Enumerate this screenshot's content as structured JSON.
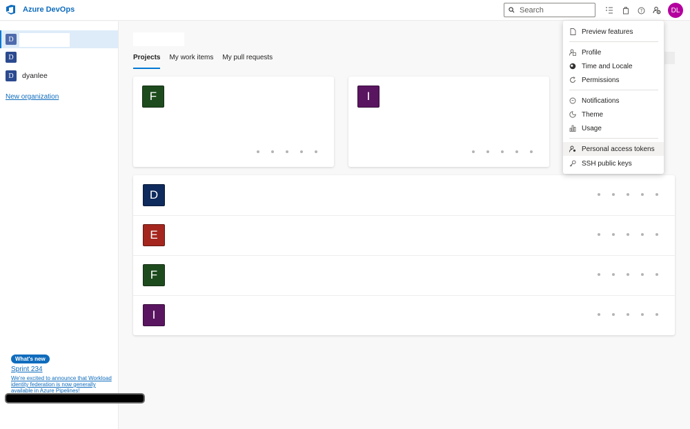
{
  "header": {
    "brand": "Azure DevOps",
    "search_placeholder": "Search",
    "avatar_initials": "DL"
  },
  "sidebar": {
    "orgs": [
      {
        "badge": "D",
        "name": ""
      },
      {
        "badge": "D",
        "name": ""
      },
      {
        "badge": "D",
        "name": "dyanlee"
      }
    ],
    "new_org": "New organization",
    "whats_new": {
      "badge": "What's new",
      "title": "Sprint 234",
      "desc": "We're excited to announce that Workload identity federation is now generally available in Azure Pipelines!"
    }
  },
  "main": {
    "tabs": [
      "Projects",
      "My work items",
      "My pull requests"
    ],
    "cards": [
      {
        "letter": "F",
        "color": "#1e4b1e"
      },
      {
        "letter": "I",
        "color": "#5a1560"
      }
    ],
    "rows": [
      {
        "letter": "D",
        "color": "#0f2a5c"
      },
      {
        "letter": "E",
        "color": "#a4261e"
      },
      {
        "letter": "F",
        "color": "#1e4b1e"
      },
      {
        "letter": "I",
        "color": "#5a1560"
      }
    ]
  },
  "menu": {
    "items": [
      {
        "label": "Preview features",
        "icon": "page-icon"
      },
      {
        "label": "Profile",
        "icon": "profile-icon"
      },
      {
        "label": "Time and Locale",
        "icon": "globe-icon"
      },
      {
        "label": "Permissions",
        "icon": "refresh-icon"
      },
      {
        "label": "Notifications",
        "icon": "chat-icon"
      },
      {
        "label": "Theme",
        "icon": "theme-icon"
      },
      {
        "label": "Usage",
        "icon": "chart-icon"
      },
      {
        "label": "Personal access tokens",
        "icon": "person-key-icon"
      },
      {
        "label": "SSH public keys",
        "icon": "key-icon"
      }
    ]
  }
}
